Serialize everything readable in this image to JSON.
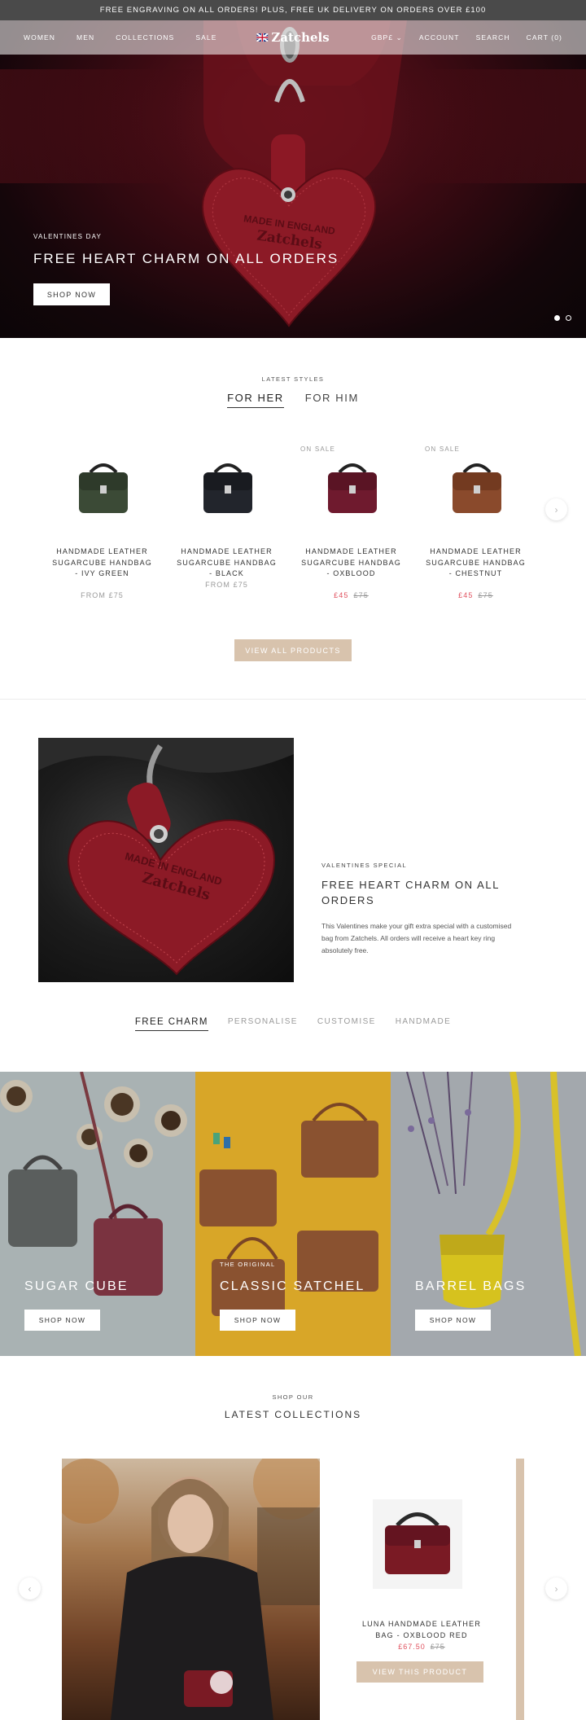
{
  "announcement": "FREE ENGRAVING ON ALL ORDERS! PLUS, FREE UK DELIVERY ON ORDERS OVER £100",
  "nav": {
    "left": [
      "WOMEN",
      "MEN",
      "COLLECTIONS",
      "SALE"
    ],
    "logo": "Zatchels",
    "currency": "GBP£",
    "account": "ACCOUNT",
    "search": "SEARCH",
    "cart": "CART (0)"
  },
  "hero": {
    "eyebrow": "VALENTINES DAY",
    "title": "FREE HEART CHARM ON ALL ORDERS",
    "button": "SHOP NOW",
    "slide_count": 2,
    "active_slide": 1
  },
  "latest": {
    "eyebrow": "LATEST STYLES",
    "tabs": [
      "FOR HER",
      "FOR HIM"
    ],
    "active_tab": 0,
    "products": [
      {
        "sale": "",
        "name": "HANDMADE LEATHER SUGARCUBE HANDBAG - IVY GREEN",
        "price": "FROM £75",
        "price_now": "",
        "price_was": "",
        "color": "#3b4a36"
      },
      {
        "sale": "",
        "name": "HANDMADE LEATHER SUGARCUBE HANDBAG - BLACK",
        "price": "FROM £75",
        "price_now": "",
        "price_was": "",
        "color": "#22252c"
      },
      {
        "sale": "ON SALE",
        "name": "HANDMADE LEATHER SUGARCUBE HANDBAG - OXBLOOD",
        "price": "",
        "price_now": "£45",
        "price_was": "£75",
        "color": "#6f1a2e"
      },
      {
        "sale": "ON SALE",
        "name": "HANDMADE LEATHER SUGARCUBE HANDBAG - CHESTNUT",
        "price": "",
        "price_now": "£45",
        "price_was": "£75",
        "color": "#8a4a2c"
      }
    ],
    "view_all": "VIEW ALL PRODUCTS"
  },
  "charm": {
    "eyebrow": "VALENTINES SPECIAL",
    "title": "FREE HEART CHARM ON ALL ORDERS",
    "text": "This Valentines make your gift extra special with a customised bag from Zatchels. All orders will receive a heart key ring absolutely free.",
    "engraving": "MADE IN ENGLAND Zatchels"
  },
  "feature_tabs": [
    "FREE CHARM",
    "PERSONALISE",
    "CUSTOMISE",
    "HANDMADE"
  ],
  "tiles": [
    {
      "sub": "",
      "label": "SUGAR CUBE",
      "button": "SHOP NOW",
      "bg": "#a9b2b3"
    },
    {
      "sub": "THE ORIGINAL",
      "label": "CLASSIC SATCHEL",
      "button": "SHOP NOW",
      "bg": "#d8a628"
    },
    {
      "sub": "",
      "label": "BARREL BAGS",
      "button": "SHOP NOW",
      "bg": "#a3a8ad"
    }
  ],
  "collections": {
    "eyebrow": "SHOP OUR",
    "title": "LATEST COLLECTIONS",
    "product_name": "LUNA HANDMADE LEATHER BAG - OXBLOOD RED",
    "price_now": "£67.50",
    "price_was": "£75",
    "button": "VIEW THIS PRODUCT"
  },
  "colors": {
    "accent_tan": "#d8c3ad",
    "sale_red": "#e0505e",
    "oxblood": "#7a1a24"
  }
}
